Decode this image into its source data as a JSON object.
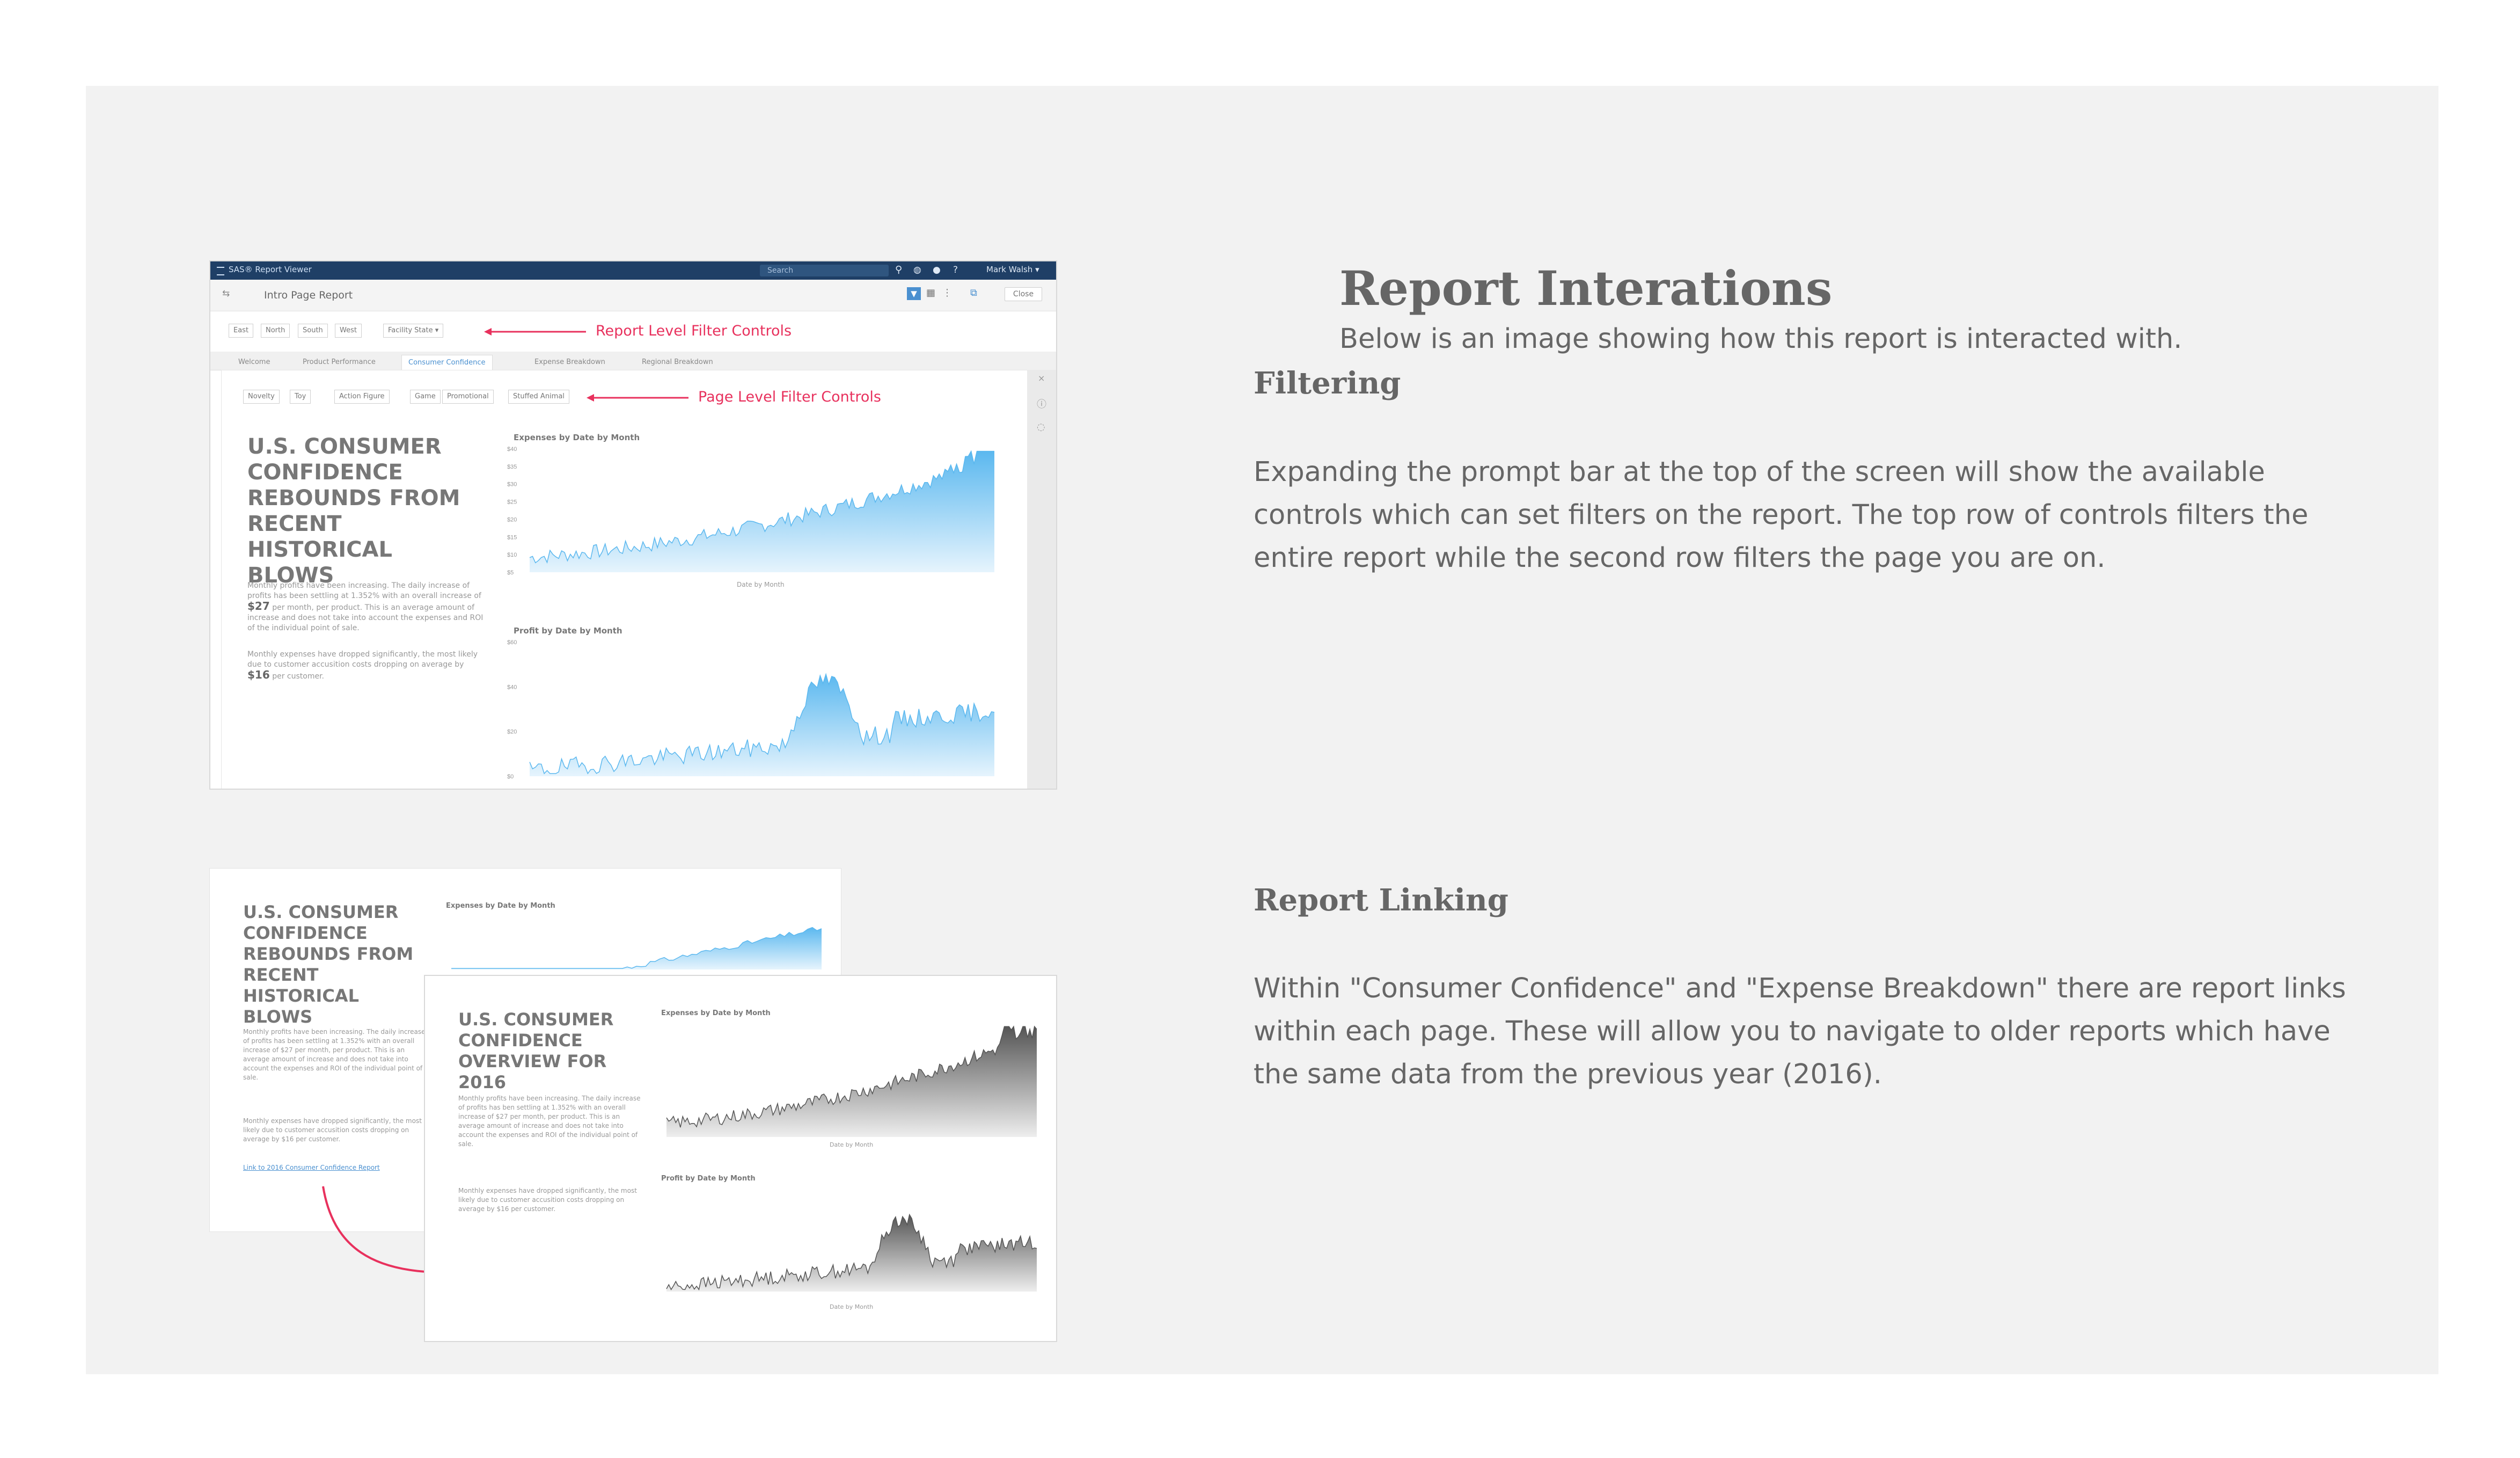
{
  "section": {
    "title": "Report Interations",
    "subtitle": "Below is an image showing how this report is interacted with."
  },
  "filtering": {
    "heading": "Filtering",
    "text": "Expanding the prompt bar at the top of the screen will show the available controls which can set filters on the report. The top row of controls filters the entire report while the second row filters the page you are on."
  },
  "linking": {
    "heading": "Report Linking",
    "text": "Within \"Consumer Confidence\" and \"Expense Breakdown\" there are report links within each page. These will allow you to navigate to older reports which have the same data from the previous year (2016)."
  },
  "shot1": {
    "app_title": "SAS® Report Viewer",
    "search_placeholder": "Search",
    "user": "Mark Walsh ▾",
    "report_name": "Intro Page Report",
    "close_label": "Close",
    "region_filters": [
      "East",
      "North",
      "South",
      "West"
    ],
    "facility_select": "Facility State ▾",
    "report_filter_label": "Report Level Filter Controls",
    "tabs": [
      "Welcome",
      "Product Performance",
      "Consumer Confidence",
      "Expense Breakdown",
      "Regional Breakdown"
    ],
    "active_tab": "Consumer Confidence",
    "page_filters_1": [
      "Novelty",
      "Toy"
    ],
    "page_filters_2": [
      "Action Figure",
      "Game",
      "Promotional",
      "Stuffed Animal"
    ],
    "page_filter_label": "Page Level Filter Controls",
    "headline": "U.S. CONSUMER CONFIDENCE REBOUNDS FROM RECENT HISTORICAL BLOWS",
    "para1_pre": "Monthly profits have been increasing. The daily increase of profits has been settling at 1.352% with an overall increase of",
    "para1_value": "$27",
    "para1_post": "per month, per product. This is an average amount of increase and does not take into account the expenses and ROI of the individual point of sale.",
    "para2_pre": "Monthly expenses have dropped significantly, the most likely due to customer accusition costs dropping on average by",
    "para2_value": "$16",
    "para2_post": "per customer.",
    "chart1_title": "Expenses by Date by Month",
    "chart1_ticks": [
      "$40",
      "$35",
      "$30",
      "$25",
      "$20",
      "$15",
      "$10",
      "$5"
    ],
    "chart1_xlabel": "Date by Month",
    "chart2_title": "Profit by Date by Month",
    "chart2_ticks": [
      "$60",
      "$40",
      "$20",
      "$0"
    ]
  },
  "shot2": {
    "back_headline": "U.S. CONSUMER CONFIDENCE REBOUNDS FROM RECENT HISTORICAL BLOWS",
    "back_para1": "Monthly profits have been increasing. The daily increase of profits has been settling at 1.352% with an overall increase of $27 per month, per product. This is an average amount of increase and does not take into account the expenses and ROI of the individual point of sale.",
    "back_para2": "Monthly expenses have dropped significantly, the most likely due to customer accusition costs dropping on average by $16 per customer.",
    "link_text": "Link to 2016 Consumer Confidence Report",
    "back_chart_title": "Expenses by Date by Month",
    "front_headline": "U.S. CONSUMER CONFIDENCE OVERVIEW FOR 2016",
    "front_para1": "Monthly profits have been increasing. The daily increase of profits has ben settling at 1.352% with an overall increase of $27 per month, per product. This is an average amount of increase and does not take into account the expenses and ROI of the individual point of sale.",
    "front_para2": "Monthly expenses have dropped significantly, the most likely due to customer accusition costs dropping on average by $16 per customer.",
    "front_chart1_title": "Expenses by Date by Month",
    "front_chart2_title": "Profit by Date by Month",
    "xlabel": "Date by Month"
  },
  "colors": {
    "panel_bg": "#f2f2f2",
    "sas_bar": "#1f3f66",
    "annotation_red": "#e8315d",
    "blue_area": "#5bb8ef",
    "gray_area": "#555555"
  }
}
